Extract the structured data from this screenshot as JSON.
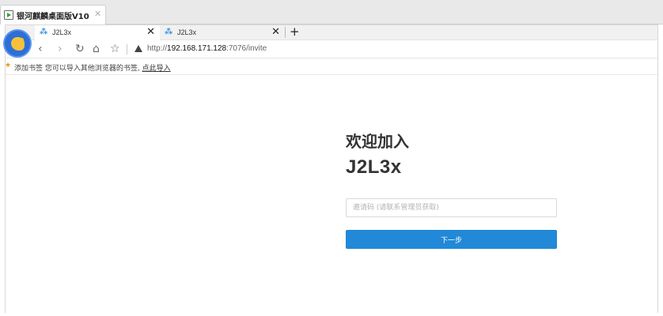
{
  "window": {
    "tab_title": "银河麒麟桌面版V10",
    "tab_close": "✕"
  },
  "browser": {
    "tabs": [
      {
        "label": "J2L3x",
        "icon": "app-tab-icon",
        "close": "✕",
        "active": true
      },
      {
        "label": "J2L3x",
        "icon": "app-tab-icon",
        "close": "✕",
        "active": false
      }
    ],
    "new_tab": "+",
    "nav": {
      "back": "‹",
      "forward": "›",
      "reload": "↻",
      "home": "⌂",
      "bookmark": "☆"
    },
    "url": {
      "scheme": "http://",
      "host": "192.168.171.128",
      "path": ":7076/invite"
    },
    "bookmarks_bar": {
      "text": "添加书签  您可以导入其他浏览器的书签,",
      "link": "点此导入"
    }
  },
  "page": {
    "welcome": "欢迎加入",
    "org_name": "J2L3x",
    "invite_input": {
      "value": "",
      "placeholder": "邀请码 (请联系管理员获取)"
    },
    "next_button": "下一步"
  },
  "colors": {
    "primary": "#2189d8",
    "title_text": "#333333",
    "bookmark_star": "#e69a1d"
  }
}
